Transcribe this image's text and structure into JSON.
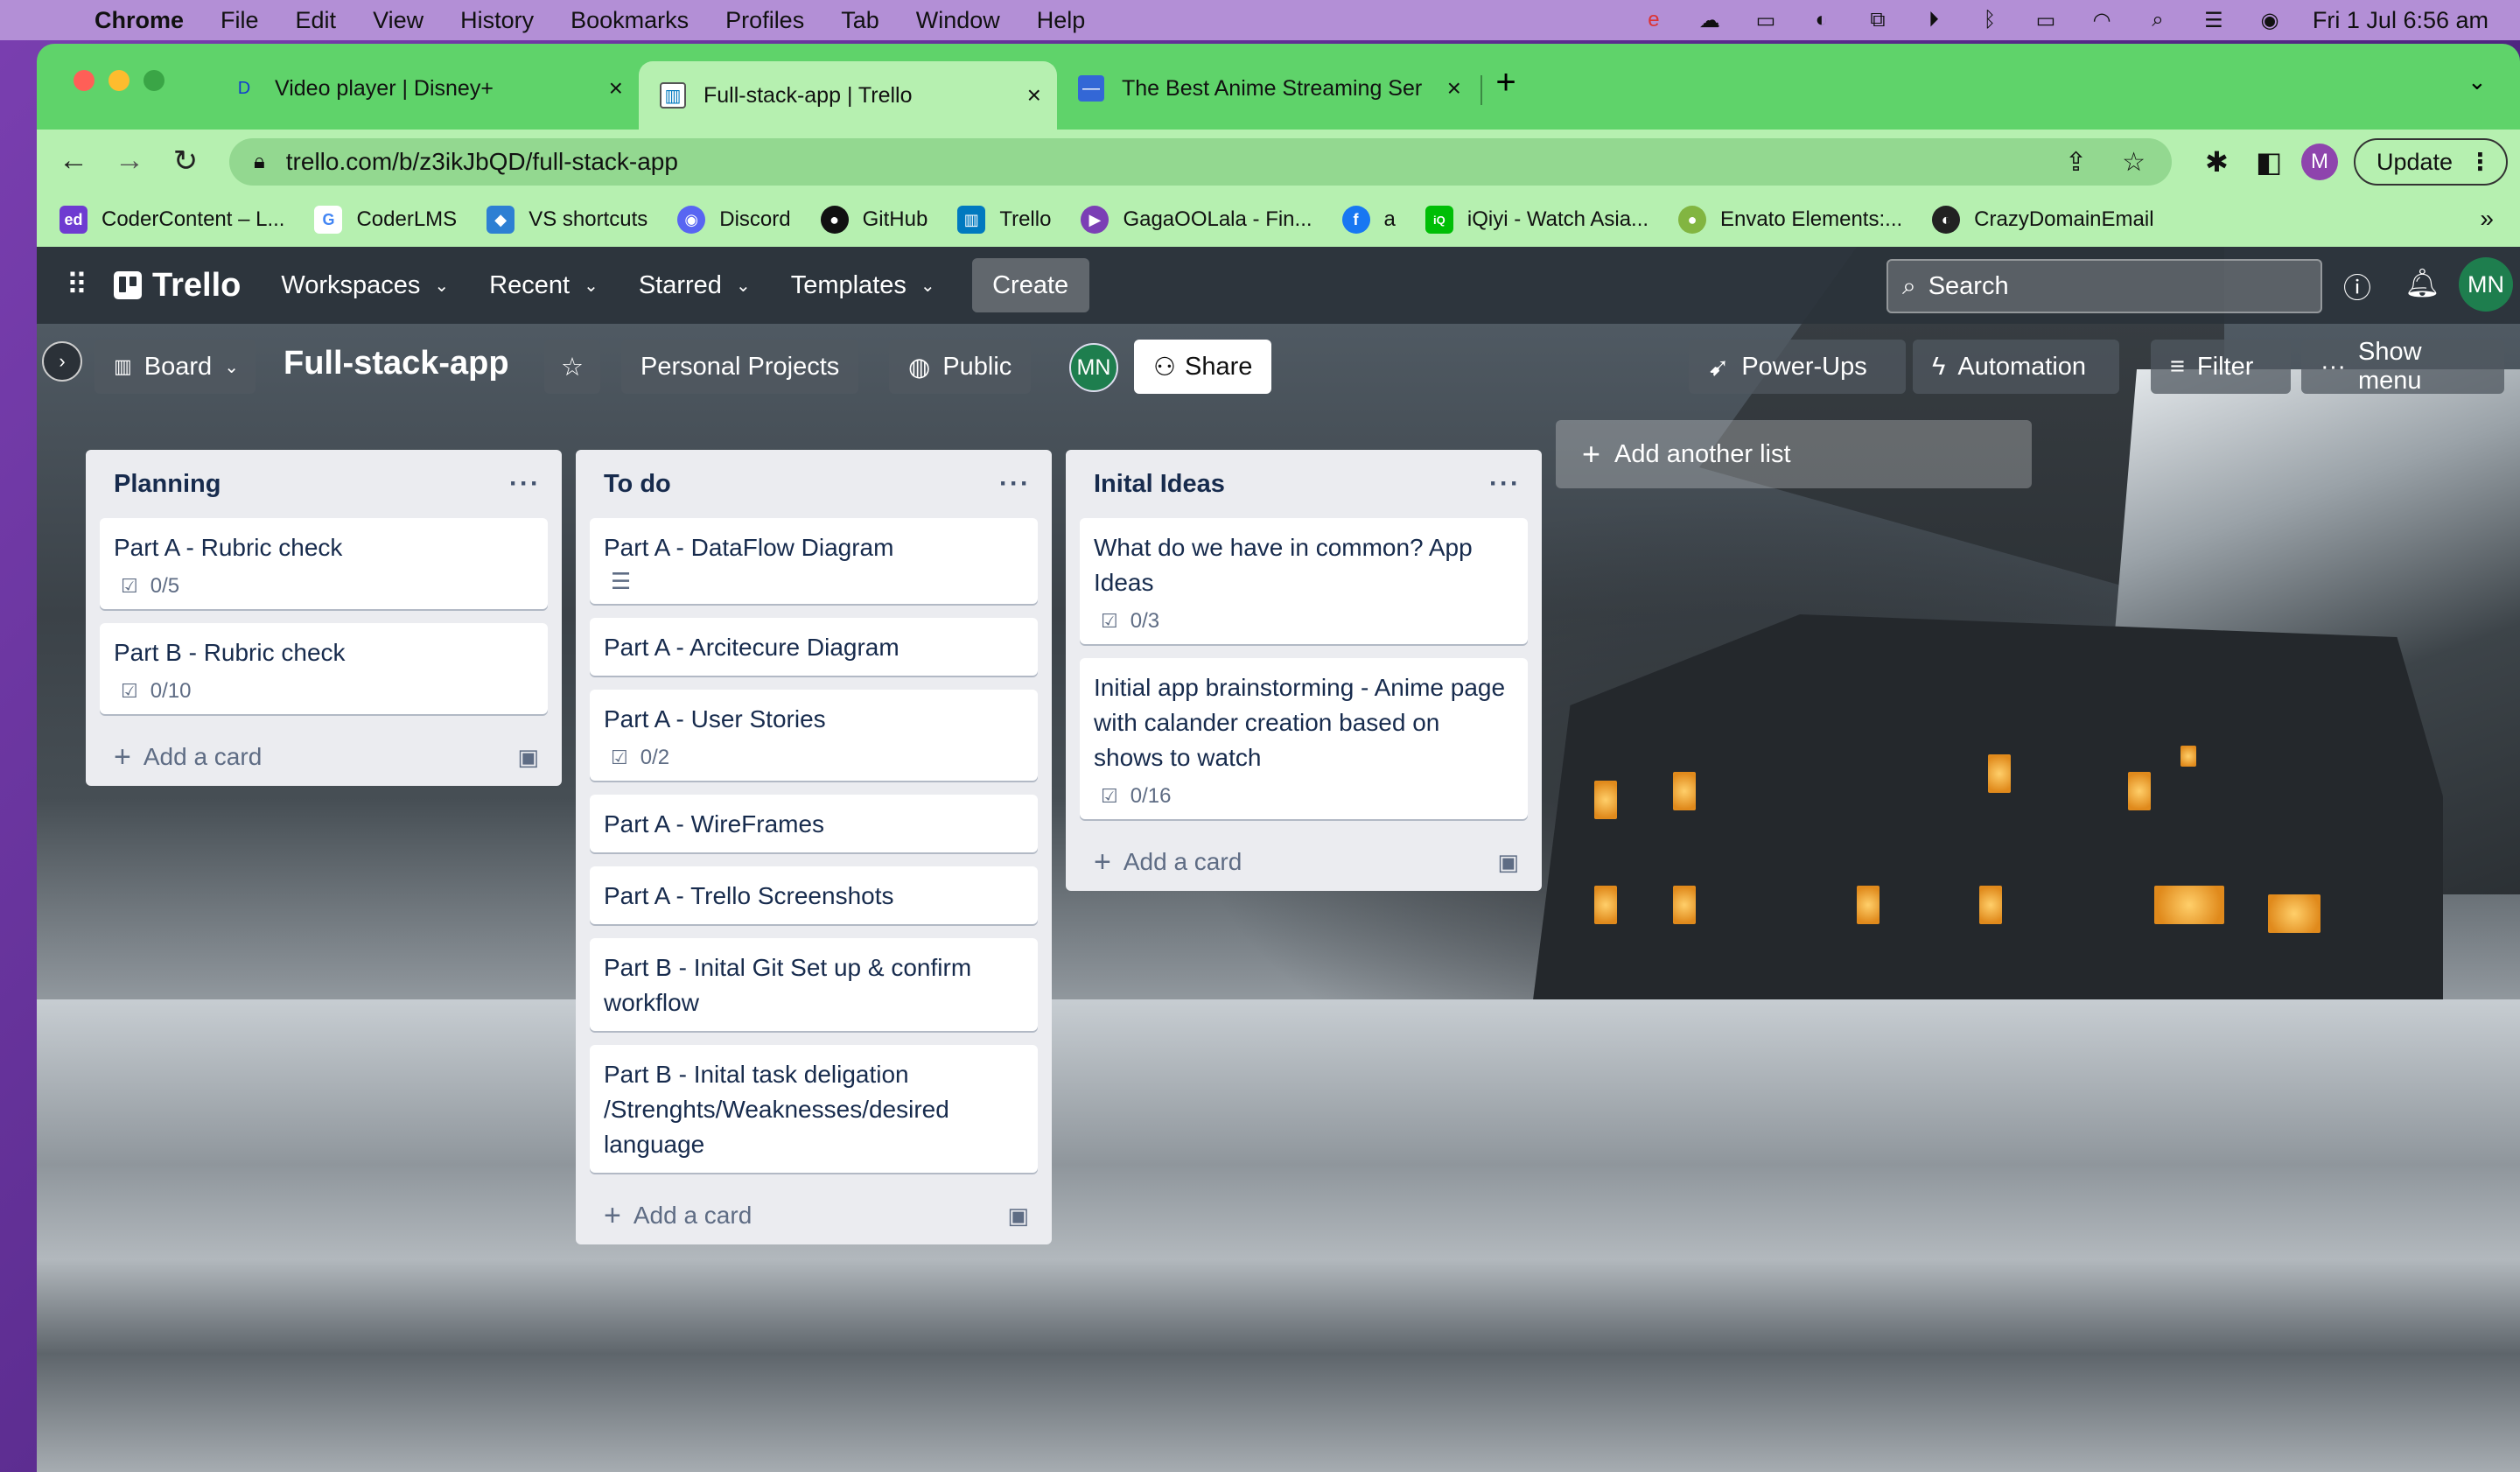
{
  "mac_menubar": {
    "app": "Chrome",
    "items": [
      "File",
      "Edit",
      "View",
      "History",
      "Bookmarks",
      "Profiles",
      "Tab",
      "Window",
      "Help"
    ],
    "clock": "Fri 1 Jul  6:56 am"
  },
  "tabs": [
    {
      "title": "Video player | Disney+",
      "icon": "disney-icon"
    },
    {
      "title": "Full-stack-app | Trello",
      "icon": "trello-icon"
    },
    {
      "title": "The Best Anime Streaming Ser",
      "icon": "site-icon"
    }
  ],
  "omnibox": {
    "url": "trello.com/b/z3ikJbQD/full-stack-app"
  },
  "profile_letter": "M",
  "update_label": "Update",
  "bookmarks": [
    {
      "label": "CoderContent – L...",
      "icon_text": "ed",
      "color": "#6e3bd1"
    },
    {
      "label": "CoderLMS",
      "icon_text": "G",
      "color": "#4285f4"
    },
    {
      "label": "VS shortcuts",
      "icon_text": "◆",
      "color": "#2d7fd3"
    },
    {
      "label": "Discord",
      "icon_text": "◉",
      "color": "#5865f2"
    },
    {
      "label": "GitHub",
      "icon_text": "●",
      "color": "#111111"
    },
    {
      "label": "Trello",
      "icon_text": "▥",
      "color": "#0079bf"
    },
    {
      "label": "GagaOOLala - Fin...",
      "icon_text": "▶",
      "color": "#7b3fb5"
    },
    {
      "label": "a",
      "icon_text": "f",
      "color": "#1877f2"
    },
    {
      "label": "iQiyi - Watch Asia...",
      "icon_text": "iQ",
      "color": "#00be06"
    },
    {
      "label": "Envato Elements:...",
      "icon_text": "●",
      "color": "#82b541"
    },
    {
      "label": "CrazyDomainEmail",
      "icon_text": "◐",
      "color": "#222222"
    }
  ],
  "trello_header": {
    "logo": "Trello",
    "nav": [
      "Workspaces",
      "Recent",
      "Starred",
      "Templates"
    ],
    "create": "Create",
    "search_placeholder": "Search",
    "avatar": "MN"
  },
  "board": {
    "view": "Board",
    "title": "Full-stack-app",
    "workspace": "Personal Projects",
    "visibility": "Public",
    "member": "MN",
    "share": "Share",
    "powerups": "Power-Ups",
    "automation": "Automation",
    "filter": "Filter",
    "show_menu": "Show menu"
  },
  "lists": [
    {
      "title": "Planning",
      "cards": [
        {
          "title": "Part A - Rubric check",
          "checklist": "0/5"
        },
        {
          "title": "Part B - Rubric check",
          "checklist": "0/10"
        }
      ],
      "add_card": "Add a card"
    },
    {
      "title": "To do",
      "cards": [
        {
          "title": "Part A - DataFlow Diagram",
          "has_description": true
        },
        {
          "title": "Part A - Arcitecure Diagram"
        },
        {
          "title": "Part A - User Stories",
          "checklist": "0/2"
        },
        {
          "title": "Part A - WireFrames"
        },
        {
          "title": "Part A - Trello Screenshots"
        },
        {
          "title": "Part B - Inital Git Set up & confirm workflow"
        },
        {
          "title": "Part B - Inital task deligation /Strenghts/Weaknesses/desired language"
        }
      ],
      "add_card": "Add a card"
    },
    {
      "title": "Inital Ideas",
      "cards": [
        {
          "title": "What do we have in common? App Ideas",
          "checklist": "0/3"
        },
        {
          "title": "Initial app brainstorming - Anime page with calander creation based on shows to watch",
          "checklist": "0/16"
        }
      ],
      "add_card": "Add a card"
    }
  ],
  "add_list": "Add another list"
}
